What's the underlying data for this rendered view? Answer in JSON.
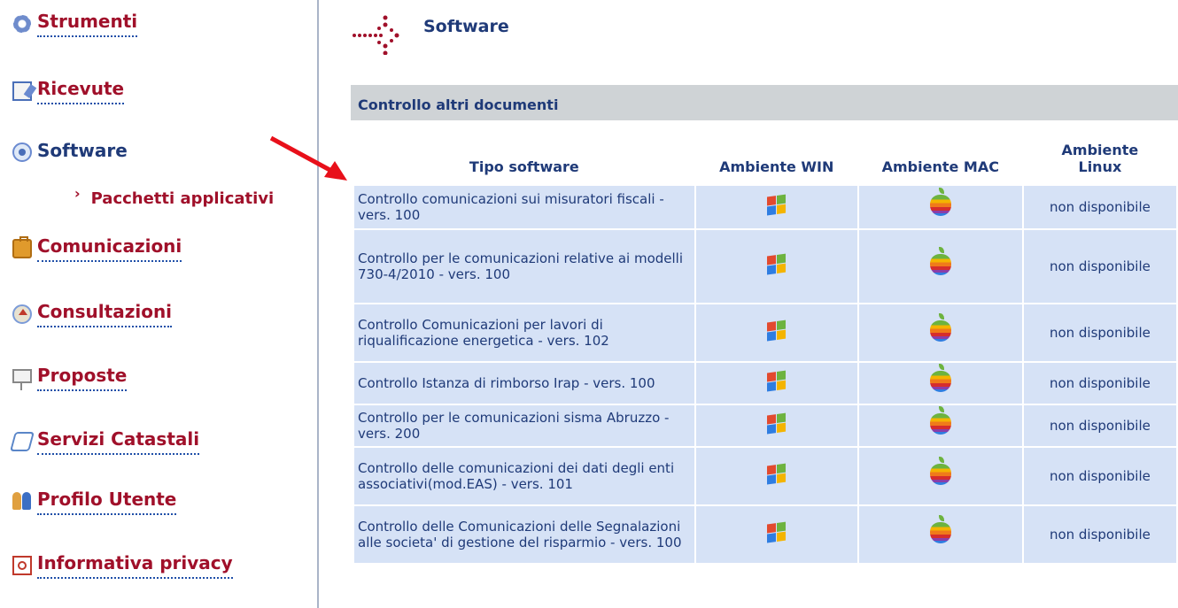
{
  "sidebar": {
    "items": [
      {
        "label": "Strumenti",
        "icon": "gear-icon"
      },
      {
        "label": "Ricevute",
        "icon": "receipt-icon"
      },
      {
        "label": "Software",
        "icon": "software-icon"
      },
      {
        "label": "Comunicazioni",
        "icon": "briefcase-icon"
      },
      {
        "label": "Consultazioni",
        "icon": "house-icon"
      },
      {
        "label": "Proposte",
        "icon": "easel-icon"
      },
      {
        "label": "Servizi Catastali",
        "icon": "cadastre-icon"
      },
      {
        "label": "Profilo Utente",
        "icon": "users-icon"
      },
      {
        "label": "Informativa privacy",
        "icon": "pdf-icon"
      }
    ],
    "sub_item": {
      "label": "Pacchetti applicativi",
      "chevron": "›"
    }
  },
  "main": {
    "title": "Software",
    "section": "Controllo altri documenti",
    "table": {
      "headers": [
        "Tipo software",
        "Ambiente WIN",
        "Ambiente MAC",
        "Ambiente Linux"
      ],
      "rows": [
        {
          "tipo": "Controllo comunicazioni sui misuratori fiscali - vers. 100",
          "linux": "non disponibile"
        },
        {
          "tipo": "Controllo per le comunicazioni relative ai modelli 730-4/2010 - vers. 100",
          "linux": "non disponibile"
        },
        {
          "tipo": "Controllo Comunicazioni per lavori di riqualificazione energetica - vers. 102",
          "linux": "non disponibile"
        },
        {
          "tipo": "Controllo Istanza di rimborso Irap - vers. 100",
          "linux": "non disponibile"
        },
        {
          "tipo": "Controllo per le comunicazioni sisma Abruzzo - vers. 200",
          "linux": "non disponibile"
        },
        {
          "tipo": "Controllo delle comunicazioni dei dati degli enti associativi(mod.EAS) - vers. 101",
          "linux": "non disponibile"
        },
        {
          "tipo": "Controllo delle Comunicazioni delle Segnalazioni alle societa' di gestione del risparmio - vers. 100",
          "linux": "non disponibile"
        }
      ]
    }
  },
  "colors": {
    "link_red": "#a0102a",
    "navy": "#1f3a78",
    "cell_bg": "#d6e2f6",
    "section_bg": "#cfd3d6",
    "arrow": "#e8101a"
  }
}
